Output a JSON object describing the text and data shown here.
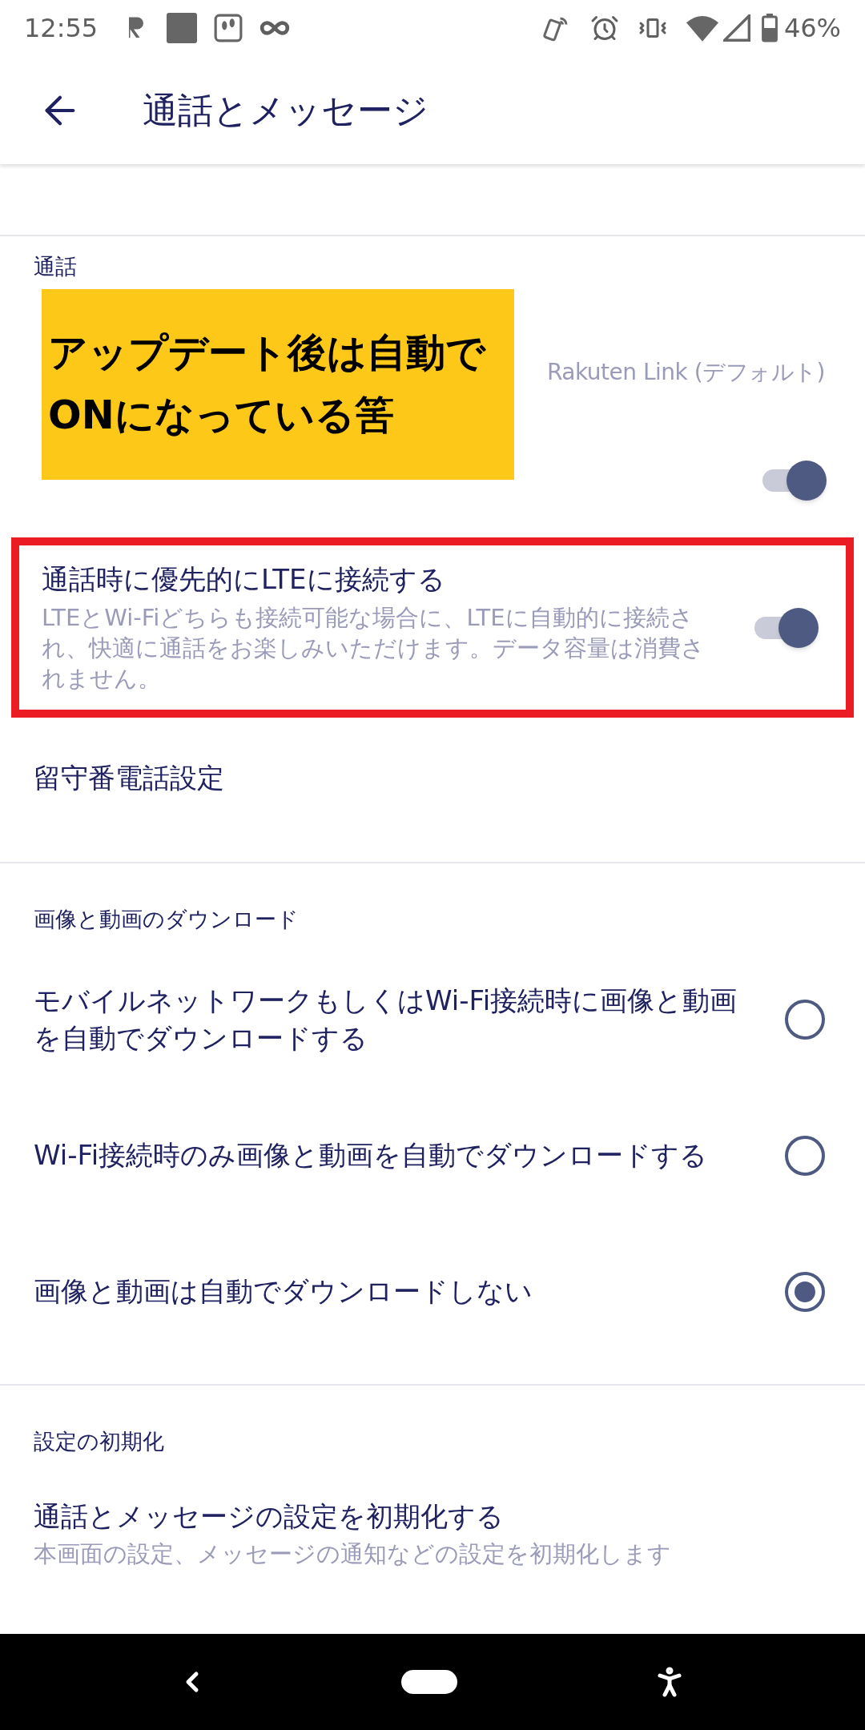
{
  "status_bar": {
    "time": "12:55",
    "battery": "46%"
  },
  "app_bar": {
    "title": "通話とメッセージ"
  },
  "sections": [
    {
      "header": "通話",
      "items": [
        {
          "kind": "value",
          "value": "Rakuten Link (デフォルト)"
        },
        {
          "kind": "toggle",
          "on": true
        },
        {
          "kind": "toggle",
          "title": "通話時に優先的にLTEに接続する",
          "description": "LTEとWi-Fiどちらも接続可能な場合に、LTEに自動的に接続され、快適に通話をお楽しみいただけます。データ容量は消費されません。",
          "on": true,
          "highlighted": true
        },
        {
          "kind": "link",
          "title": "留守番電話設定"
        }
      ]
    },
    {
      "header": "画像と動画のダウンロード",
      "items": [
        {
          "kind": "radio",
          "title": "モバイルネットワークもしくはWi-Fi接続時に画像と動画を自動でダウンロードする",
          "selected": false
        },
        {
          "kind": "radio",
          "title": "Wi-Fi接続時のみ画像と動画を自動でダウンロードする",
          "selected": false
        },
        {
          "kind": "radio",
          "title": "画像と動画は自動でダウンロードしない",
          "selected": true
        }
      ]
    },
    {
      "header": "設定の初期化",
      "items": [
        {
          "kind": "link",
          "title": "通話とメッセージの設定を初期化する",
          "description": "本画面の設定、メッセージの通知などの設定を初期化します"
        }
      ]
    }
  ],
  "annotation": {
    "lines": [
      "アップデート後は自動で",
      "ONになっている筈"
    ]
  }
}
